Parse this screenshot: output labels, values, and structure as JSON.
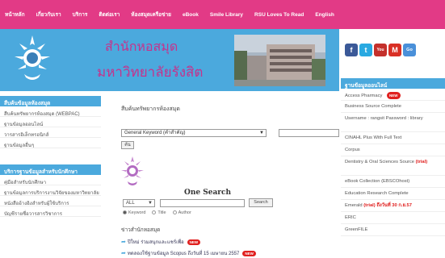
{
  "nav": {
    "items": [
      "หน้าหลัก",
      "เกี่ยวกับเรา",
      "บริการ",
      "ติดต่อเรา",
      "ห้องสมุดเครือข่าย",
      "eBook",
      "Smile Library",
      "RSU Loves To Read",
      "English"
    ]
  },
  "banner": {
    "title_line1": "สำนักหอสมุด",
    "title_line2": "มหาวิทยาลัยรังสิต"
  },
  "social": [
    "f",
    "t",
    "You",
    "M",
    "Go"
  ],
  "left": {
    "section1": {
      "header": "สืบค้นข้อมูลห้องสมุด",
      "items": [
        "สืบค้นทรัพยากรห้องสมุด (WEBPAC)",
        "ฐานข้อมูลออนไลน์",
        "วารสารอิเล็กทรอนิกส์",
        "ฐานข้อมูลอื่นๆ"
      ]
    },
    "section2": {
      "header": "บริการฐานข้อมูลสำหรับนักศึกษา",
      "items": [
        "คู่มือสำหรับนักศึกษา",
        "ฐานข้อมูลการบริการงานวิจัยของมหาวิทยาลัย",
        "หนังสืออ้างอิงสำหรับผู้ใช้บริการ",
        "บัญชีรายชื่อวารสารวิชาการ"
      ]
    }
  },
  "main": {
    "heading": "สืบค้นทรัพยากรห้องสมุด",
    "select_value": "General Keyword (คำสำคัญ)",
    "go_label": "ค้น",
    "os_title": "One Search",
    "all_value": "ALL",
    "search_label": "Search",
    "radio_keyword": "Keyword",
    "radio_title": "Title",
    "radio_author": "Author",
    "news_header": "ข่าวสำนักหอสมุด",
    "news1": "ปีใหม่ ร่วมสนุกและแชร์เพื่อ",
    "news2": "ทดลองใช้ฐานข้อมูล Scopus ถึงวันที่ 15 เมษายน 2557",
    "new_badge": "NEW"
  },
  "right": {
    "header": "ฐานข้อมูลออนไลน์",
    "items": [
      "Access Pharmacy",
      "Business Source Complete",
      "Username : rangsit Password : library",
      "CINAHL Plus With Full Text",
      "Corpus",
      "Dentistry & Oral Sciences Source",
      "eBook Collection (EBSCOhost)",
      "Education Research Complete",
      "Emerald",
      "ERIC",
      "GreenFILE"
    ],
    "new_badge": "NEW",
    "trial_label": "(trial)",
    "emerald_trial": "(trial) ถึงวันที่ 30 ก.ย.57"
  },
  "colors": {
    "nav_bg": "#e23a86",
    "banner_bg": "#4ba9dd",
    "title_text": "#c5338c",
    "new_badge": "#e0201f"
  }
}
